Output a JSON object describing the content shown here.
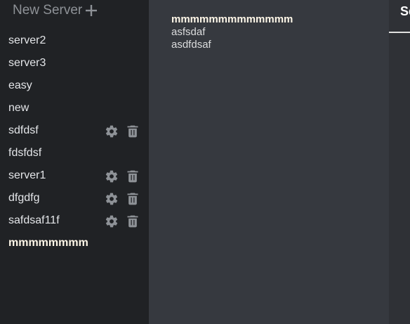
{
  "sidebar": {
    "new_server_label": "New Server",
    "new_server_icon": "plus-icon",
    "servers": [
      {
        "name": "server2",
        "actions": false,
        "active": false
      },
      {
        "name": "server3",
        "actions": false,
        "active": false
      },
      {
        "name": "easy",
        "actions": false,
        "active": false
      },
      {
        "name": "new",
        "actions": false,
        "active": false
      },
      {
        "name": "sdfdsf",
        "actions": true,
        "active": false
      },
      {
        "name": "fdsfdsf",
        "actions": false,
        "active": false
      },
      {
        "name": "server1",
        "actions": true,
        "active": false
      },
      {
        "name": "dfgdfg",
        "actions": true,
        "active": false
      },
      {
        "name": "safdsaf11f",
        "actions": true,
        "active": false
      },
      {
        "name": "mmmmmmmm",
        "actions": false,
        "active": true
      }
    ]
  },
  "main": {
    "title": "mmmmmmmmmmmmm",
    "lines": [
      "asfsdaf",
      "asdfdsaf"
    ]
  },
  "right_panel": {
    "title": "Se"
  },
  "icons": {
    "settings": "gear-icon",
    "delete": "trash-icon"
  },
  "colors": {
    "sidebar_bg": "#202225",
    "main_bg": "#36393f",
    "right_bg": "#2f3136",
    "icon": "#8e9297",
    "active_text": "#fff7e8"
  }
}
